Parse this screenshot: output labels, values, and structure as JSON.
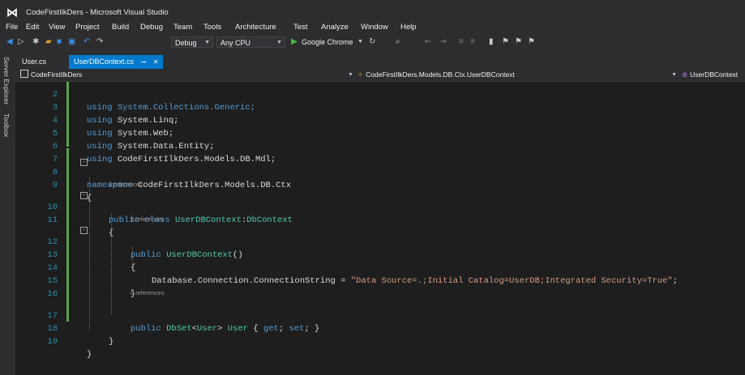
{
  "window": {
    "title": "CodeFirstIlkDers - Microsoft Visual Studio"
  },
  "menu": [
    "File",
    "Edit",
    "View",
    "Project",
    "Build",
    "Debug",
    "Team",
    "Tools",
    "Architecture",
    "Test",
    "Analyze",
    "Window",
    "Help"
  ],
  "toolbar": {
    "config": "Debug",
    "platform": "Any CPU",
    "run_label": "Google Chrome"
  },
  "side_tabs": [
    "Server Explorer",
    "Toolbox"
  ],
  "tabs": [
    {
      "label": "User.cs",
      "active": false
    },
    {
      "label": "UserDBContext.cs",
      "active": true
    }
  ],
  "navbar": {
    "project": "CodeFirstIlkDers",
    "type": "CodeFirstIlkDers.Models.DB.Ctx.UserDBContext",
    "member": "UserDBContext"
  },
  "code": {
    "ref_3": "3 references",
    "ref_0": "0 references",
    "lines": [
      {
        "n": "2",
        "t": "using System.Collections.Generic;"
      },
      {
        "n": "3",
        "t": "using System.Linq;"
      },
      {
        "n": "4",
        "t": "using System.Web;"
      },
      {
        "n": "5",
        "t": "using System.Data.Entity;"
      },
      {
        "n": "6",
        "t": "using CodeFirstIlkDers.Models.DB.Mdl;"
      },
      {
        "n": "7",
        "t": ""
      },
      {
        "n": "8",
        "t": "namespace CodeFirstIlkDers.Models.DB.Ctx"
      },
      {
        "n": "9",
        "t": "{"
      },
      {
        "n": "10",
        "t": "public class UserDBContext:DbContext"
      },
      {
        "n": "11",
        "t": "{"
      },
      {
        "n": "12",
        "t": "public UserDBContext()"
      },
      {
        "n": "13",
        "t": "{"
      },
      {
        "n": "14",
        "t": "Database.Connection.ConnectionString = \"Data Source=.;Initial Catalog=UserDB;Integrated Security=True\";"
      },
      {
        "n": "15",
        "t": "}"
      },
      {
        "n": "16",
        "t": ""
      },
      {
        "n": "17",
        "t": "public DbSet<User> User { get; set; }"
      },
      {
        "n": "18",
        "t": "}"
      },
      {
        "n": "19",
        "t": "}"
      }
    ]
  },
  "colors": {
    "keyword": "#569cd6",
    "type": "#4ec9b0",
    "string": "#d69d85",
    "line_number": "#2b91af",
    "accent": "#007acc"
  },
  "icons": [
    "vs-logo-icon",
    "nav-back-icon",
    "nav-forward-icon",
    "new-project-icon",
    "open-file-icon",
    "save-icon",
    "save-all-icon",
    "undo-icon",
    "redo-icon",
    "start-debug-icon",
    "refresh-icon",
    "bookmark-icon"
  ]
}
